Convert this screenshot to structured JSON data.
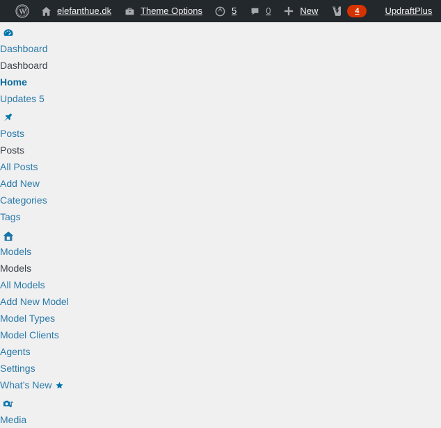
{
  "adminbar": {
    "items": [
      {
        "name": "wp-logo",
        "icon": "wordpress-logo-icon",
        "label": ""
      },
      {
        "name": "site-name",
        "icon": "home-icon",
        "label": "elefanthue.dk"
      },
      {
        "name": "theme-options",
        "icon": "briefcase-icon",
        "label": "Theme Options"
      },
      {
        "name": "updates",
        "icon": "update-arrows-icon",
        "label": "5"
      },
      {
        "name": "comments",
        "icon": "comment-bubble-icon",
        "label": "0"
      },
      {
        "name": "new-content",
        "icon": "plus-icon",
        "label": "New"
      },
      {
        "name": "yoast-seo",
        "icon": "yoast-logo-icon",
        "label": "4"
      },
      {
        "name": "updraftplus",
        "icon": "",
        "label": "UpdraftPlus"
      }
    ],
    "site_name": "elefanthue.dk",
    "theme_options": "Theme Options",
    "updates_count": "5",
    "comments_count": "0",
    "new_label": "New",
    "yoast_count": "4",
    "updraftplus": "UpdraftPlus"
  },
  "colors": {
    "adminbar_bg": "#23282d",
    "adminbar_text": "#f0f0f1",
    "adminbar_dim": "#a7aaad",
    "body_bg": "#f0f0f1",
    "link": "#2a7aa8",
    "link_current": "#0b6a9c",
    "plain_text": "#3c434a",
    "icon_blue": "#0073aa",
    "badge_red": "#d63301"
  },
  "menu": [
    {
      "id": "dashboard",
      "icon": "dashboard-gauge-icon",
      "top_label": "Dashboard",
      "name_label": "Dashboard",
      "submenu": [
        {
          "label": "Home",
          "current": true
        },
        {
          "label": "Updates 5",
          "current": false
        }
      ]
    },
    {
      "id": "posts",
      "icon": "pushpin-icon",
      "top_label": "Posts",
      "name_label": "Posts",
      "submenu": [
        {
          "label": "All Posts",
          "current": false
        },
        {
          "label": "Add New",
          "current": false
        },
        {
          "label": "Categories",
          "current": false
        },
        {
          "label": "Tags",
          "current": false
        }
      ]
    },
    {
      "id": "models",
      "icon": "house-icon",
      "top_label": "Models",
      "name_label": "Models",
      "submenu": [
        {
          "label": "All Models",
          "current": false
        },
        {
          "label": "Add New Model",
          "current": false
        },
        {
          "label": "Model Types",
          "current": false
        },
        {
          "label": "Model Clients",
          "current": false
        },
        {
          "label": "Agents",
          "current": false
        },
        {
          "label": "Settings",
          "current": false
        },
        {
          "label": "What’s New",
          "current": false,
          "star": true
        }
      ]
    },
    {
      "id": "media",
      "icon": "media-camera-note-icon",
      "top_label": "Media",
      "name_label": "",
      "submenu": []
    }
  ]
}
